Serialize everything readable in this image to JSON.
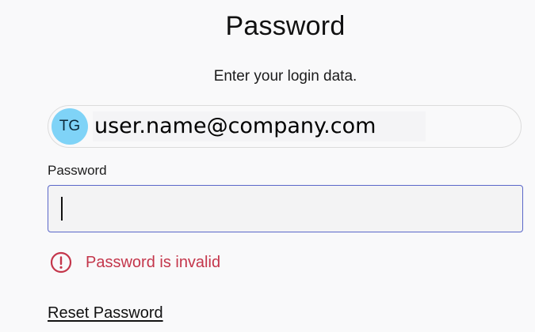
{
  "header": {
    "title": "Password",
    "subtitle": "Enter your login data."
  },
  "account": {
    "initials": "TG",
    "email": "user.name@company.com",
    "avatar_color": "#7fd3f7"
  },
  "password_field": {
    "label": "Password",
    "value": "",
    "border_color": "#5a67c9"
  },
  "error": {
    "icon": "exclamation-circle-icon",
    "message": "Password is invalid",
    "color": "#c4364b"
  },
  "links": {
    "reset_password": "Reset Password"
  }
}
